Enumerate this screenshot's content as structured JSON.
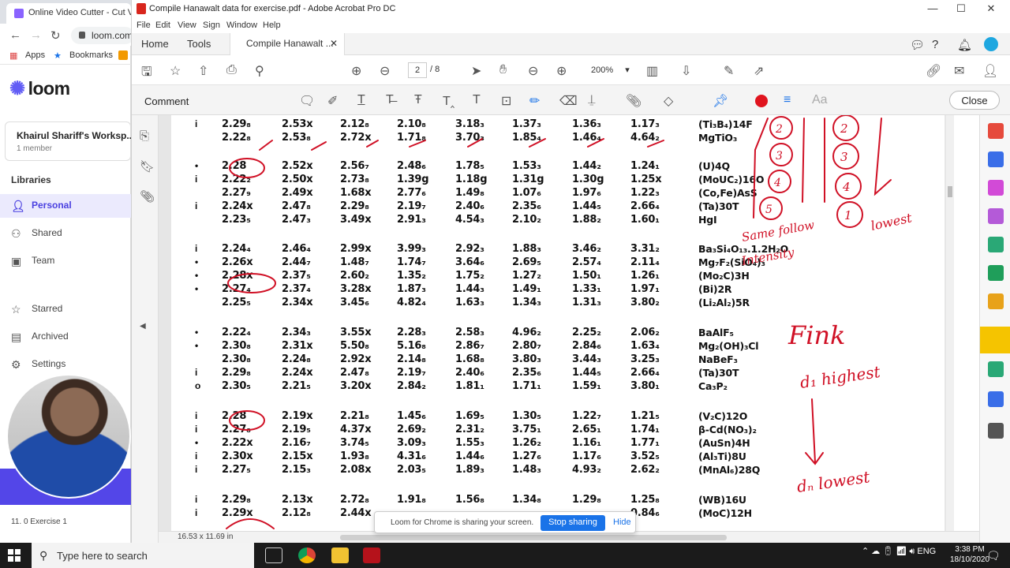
{
  "bg_browser": {
    "tab_title": "Online Video Cutter - Cut Vid",
    "url": "loom.com",
    "bookmarks": [
      "Apps",
      "Bookmarks"
    ],
    "logo": "loom",
    "workspace_name": "Khairul Shariff's Worksp...",
    "workspace_members": "1 member",
    "libraries_label": "Libraries",
    "nav": [
      {
        "label": "Personal",
        "icon": "person-icon"
      },
      {
        "label": "Shared",
        "icon": "shared-icon"
      },
      {
        "label": "Team",
        "icon": "team-icon"
      },
      {
        "label": "Starred",
        "icon": "star-icon"
      },
      {
        "label": "Archived",
        "icon": "archive-icon"
      },
      {
        "label": "Settings",
        "icon": "gear-icon"
      }
    ],
    "exercise_item": "11. 0 Exercise 1"
  },
  "acrobat": {
    "window_title": "Compile Hanawalt data for exercise.pdf - Adobe Acrobat Pro DC",
    "menu": [
      "File",
      "Edit",
      "View",
      "Sign",
      "Window",
      "Help"
    ],
    "tabs": {
      "home": "Home",
      "tools": "Tools",
      "document": "Compile Hanawalt ..."
    },
    "page_current": "2",
    "page_total": "/ 8",
    "zoom": "200%",
    "comment_label": "Comment",
    "close_label": "Close",
    "page_size": "16.53 x 11.69 in",
    "accent_color": "#e0141e"
  },
  "doc_rows": [
    {
      "mark": "i",
      "cols": [
        "2.29₈",
        "2.53x",
        "2.12₈",
        "2.10₈",
        "3.18₃",
        "1.37₃",
        "1.36₃",
        "1.17₃"
      ],
      "compound": "(Ti₃B₄)14F"
    },
    {
      "mark": "",
      "cols": [
        "2.22₈",
        "2.53₈",
        "2.72x",
        "1.71₈",
        "3.70₃",
        "1.85₄",
        "1.46₄",
        "4.64₂"
      ],
      "compound": "MgTiO₃"
    },
    {
      "mark": "•",
      "cols": [
        "2.28",
        "2.52x",
        "2.56₇",
        "2.48₆",
        "1.78₅",
        "1.53₃",
        "1.44₂",
        "1.24₁"
      ],
      "compound": "(U)4Q"
    },
    {
      "mark": "i",
      "cols": [
        "2.22₂",
        "2.50x",
        "2.73₈",
        "1.39g",
        "1.18g",
        "1.31g",
        "1.30g",
        "1.25x"
      ],
      "compound": "(MoUC₂)16O"
    },
    {
      "mark": "",
      "cols": [
        "2.27₉",
        "2.49x",
        "1.68x",
        "2.77₆",
        "1.49₈",
        "1.07₆",
        "1.97₆",
        "1.22₃"
      ],
      "compound": "(Co,Fe)AsS"
    },
    {
      "mark": "i",
      "cols": [
        "2.24x",
        "2.47₈",
        "2.29₈",
        "2.19₇",
        "2.40₆",
        "2.35₆",
        "1.44₅",
        "2.66₄"
      ],
      "compound": "(Ta)30T"
    },
    {
      "mark": "",
      "cols": [
        "2.23₅",
        "2.47₃",
        "3.49x",
        "2.91₃",
        "4.54₃",
        "2.10₂",
        "1.88₂",
        "1.60₁"
      ],
      "compound": "HgI"
    },
    {
      "mark": "i",
      "cols": [
        "2.24₄",
        "2.46₄",
        "2.99x",
        "3.99₃",
        "2.92₃",
        "1.88₃",
        "3.46₂",
        "3.31₂"
      ],
      "compound": "Ba₃Si₄O₁₃.1.2H₂O"
    },
    {
      "mark": "•",
      "cols": [
        "2.26x",
        "2.44₇",
        "1.48₇",
        "1.74₇",
        "3.64₆",
        "2.69₅",
        "2.57₄",
        "2.11₄"
      ],
      "compound": "Mg₇F₂(SiO₄)₃"
    },
    {
      "mark": "•",
      "cols": [
        "2.28x",
        "2.37₅",
        "2.60₂",
        "1.35₂",
        "1.75₂",
        "1.27₂",
        "1.50₁",
        "1.26₁"
      ],
      "compound": "(Mo₂C)3H"
    },
    {
      "mark": "•",
      "cols": [
        "2.27₄",
        "2.37₄",
        "3.28x",
        "1.87₃",
        "1.44₃",
        "1.49₁",
        "1.33₁",
        "1.97₁"
      ],
      "compound": "(Bi)2R"
    },
    {
      "mark": "",
      "cols": [
        "2.25₅",
        "2.34x",
        "3.45₆",
        "4.82₄",
        "1.63₃",
        "1.34₃",
        "1.31₃",
        "3.80₂"
      ],
      "compound": "(Li₂Al₂)5R"
    },
    {
      "mark": "•",
      "cols": [
        "2.22₄",
        "2.34₃",
        "3.55x",
        "2.28₃",
        "2.58₃",
        "4.96₂",
        "2.25₂",
        "2.06₂"
      ],
      "compound": "BaAlF₅"
    },
    {
      "mark": "•",
      "cols": [
        "2.30₈",
        "2.31x",
        "5.50₈",
        "5.16₈",
        "2.86₇",
        "2.80₇",
        "2.84₆",
        "1.63₄"
      ],
      "compound": "Mg₂(OH)₃Cl"
    },
    {
      "mark": "",
      "cols": [
        "2.30₈",
        "2.24₈",
        "2.92x",
        "2.14₈",
        "1.68₈",
        "3.80₃",
        "3.44₃",
        "3.25₃"
      ],
      "compound": "NaBeF₃"
    },
    {
      "mark": "i",
      "cols": [
        "2.29₈",
        "2.24x",
        "2.47₈",
        "2.19₇",
        "2.40₆",
        "2.35₆",
        "1.44₅",
        "2.66₄"
      ],
      "compound": "(Ta)30T"
    },
    {
      "mark": "o",
      "cols": [
        "2.30₅",
        "2.21₅",
        "3.20x",
        "2.84₂",
        "1.81₁",
        "1.71₁",
        "1.59₁",
        "3.80₁"
      ],
      "compound": "Ca₃P₂"
    },
    {
      "mark": "i",
      "cols": [
        "2.28",
        "2.19x",
        "2.21₈",
        "1.45₆",
        "1.69₅",
        "1.30₅",
        "1.22₇",
        "1.21₅"
      ],
      "compound": "(V₂C)12O"
    },
    {
      "mark": "i",
      "cols": [
        "2.27₈",
        "2.19₅",
        "4.37x",
        "2.69₂",
        "2.31₂",
        "3.75₁",
        "2.65₁",
        "1.74₁"
      ],
      "compound": "β-Cd(NO₃)₂"
    },
    {
      "mark": "•",
      "cols": [
        "2.22x",
        "2.16₇",
        "3.74₅",
        "3.09₃",
        "1.55₃",
        "1.26₂",
        "1.16₁",
        "1.77₁"
      ],
      "compound": "(AuSn)4H"
    },
    {
      "mark": "i",
      "cols": [
        "2.30x",
        "2.15x",
        "1.93₈",
        "4.31₆",
        "1.44₆",
        "1.27₆",
        "1.17₆",
        "3.52₅"
      ],
      "compound": "(Al₃Ti)8U"
    },
    {
      "mark": "i",
      "cols": [
        "2.27₅",
        "2.15₃",
        "2.08x",
        "2.03₅",
        "1.89₃",
        "1.48₃",
        "4.93₂",
        "2.62₂"
      ],
      "compound": "(MnAl₆)28Q"
    },
    {
      "mark": "i",
      "cols": [
        "2.29₈",
        "2.13x",
        "2.72₈",
        "1.91₈",
        "1.56₈",
        "1.34₈",
        "1.29₈",
        "1.25₈"
      ],
      "compound": "(WB)16U"
    },
    {
      "mark": "i",
      "cols": [
        "2.29x",
        "2.12₈",
        "2.44x",
        "",
        "",
        "",
        "",
        "0.84₆"
      ],
      "compound": "(MoC)12H"
    }
  ],
  "annotations": {
    "numbers": [
      "1",
      "2",
      "3",
      "4",
      "5"
    ],
    "same_follow": "Same follow",
    "intensity": "Intensity",
    "lowest_top": "lowest",
    "fink": "Fink",
    "d1_highest": "d₁ highest",
    "dn_lowest": "dₙ lowest",
    "ink_color": "#d01025"
  },
  "share_notification": {
    "message": "Loom for Chrome is sharing your screen.",
    "stop_label": "Stop sharing",
    "hide_label": "Hide"
  },
  "taskbar": {
    "search_placeholder": "Type here to search",
    "language": "ENG",
    "time": "3:38 PM",
    "date": "18/10/2020"
  }
}
